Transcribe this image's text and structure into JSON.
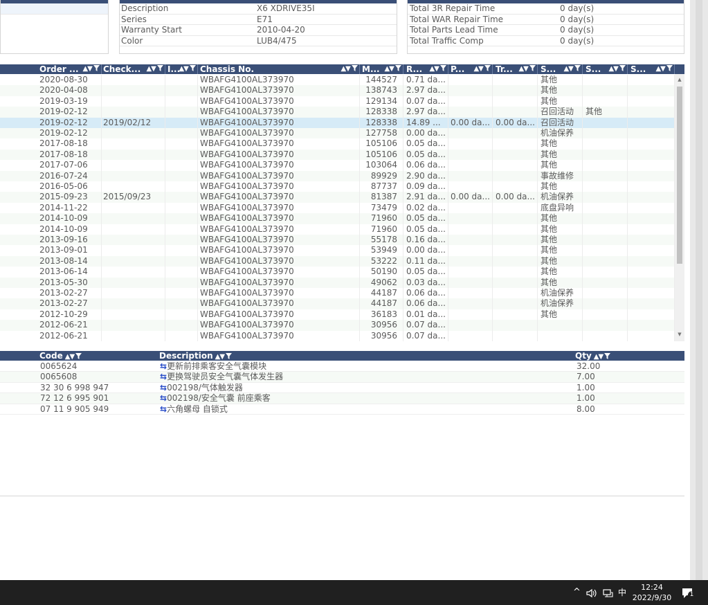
{
  "vehicle_panel": {
    "rows": [
      {
        "label": "Description",
        "value": "X6 XDRIVE35I"
      },
      {
        "label": "Series",
        "value": "E71"
      },
      {
        "label": "Warranty Start",
        "value": "2010-04-20"
      },
      {
        "label": "Color",
        "value": "LUB4/475"
      }
    ]
  },
  "totals_panel": {
    "rows": [
      {
        "label": "Total 3R Repair Time",
        "value": "0 day(s)"
      },
      {
        "label": "Total WAR Repair Time",
        "value": "0 day(s)"
      },
      {
        "label": "Total Parts Lead Time",
        "value": "0 day(s)"
      },
      {
        "label": "Total Traffic Comp",
        "value": "0 day(s)"
      }
    ]
  },
  "orders_grid": {
    "headers": [
      "Order ...",
      "Check...",
      "I...",
      "Chassis No.",
      "M...",
      "R...",
      "P...",
      "Tr...",
      "S...",
      "S...",
      "S..."
    ],
    "rows": [
      [
        "2020-08-30",
        "",
        "",
        "WBAFG4100AL373970",
        "144527",
        "0.71 da...",
        "",
        "",
        "其他",
        "",
        ""
      ],
      [
        "2020-04-08",
        "",
        "",
        "WBAFG4100AL373970",
        "138743",
        "2.97 da...",
        "",
        "",
        "其他",
        "",
        ""
      ],
      [
        "2019-03-19",
        "",
        "",
        "WBAFG4100AL373970",
        "129134",
        "0.07 da...",
        "",
        "",
        "其他",
        "",
        ""
      ],
      [
        "2019-02-12",
        "",
        "",
        "WBAFG4100AL373970",
        "128338",
        "2.97 da...",
        "",
        "",
        "召回活动",
        "其他",
        ""
      ],
      [
        "2019-02-12",
        "2019/02/12",
        "",
        "WBAFG4100AL373970",
        "128338",
        "14.89 ...",
        "0.00 da...",
        "0.00 da...",
        "召回活动",
        "",
        ""
      ],
      [
        "2019-02-12",
        "",
        "",
        "WBAFG4100AL373970",
        "127758",
        "0.00 da...",
        "",
        "",
        "机油保养",
        "",
        ""
      ],
      [
        "2017-08-18",
        "",
        "",
        "WBAFG4100AL373970",
        "105106",
        "0.05 da...",
        "",
        "",
        "其他",
        "",
        ""
      ],
      [
        "2017-08-18",
        "",
        "",
        "WBAFG4100AL373970",
        "105106",
        "0.05 da...",
        "",
        "",
        "其他",
        "",
        ""
      ],
      [
        "2017-07-06",
        "",
        "",
        "WBAFG4100AL373970",
        "103064",
        "0.06 da...",
        "",
        "",
        "其他",
        "",
        ""
      ],
      [
        "2016-07-24",
        "",
        "",
        "WBAFG4100AL373970",
        "89929",
        "2.90 da...",
        "",
        "",
        "事故维修",
        "",
        ""
      ],
      [
        "2016-05-06",
        "",
        "",
        "WBAFG4100AL373970",
        "87737",
        "0.09 da...",
        "",
        "",
        "其他",
        "",
        ""
      ],
      [
        "2015-09-23",
        "2015/09/23",
        "",
        "WBAFG4100AL373970",
        "81387",
        "2.91 da...",
        "0.00 da...",
        "0.00 da...",
        "机油保养",
        "",
        ""
      ],
      [
        "2014-11-22",
        "",
        "",
        "WBAFG4100AL373970",
        "73479",
        "0.02 da...",
        "",
        "",
        "底盘异响",
        "",
        ""
      ],
      [
        "2014-10-09",
        "",
        "",
        "WBAFG4100AL373970",
        "71960",
        "0.05 da...",
        "",
        "",
        "其他",
        "",
        ""
      ],
      [
        "2014-10-09",
        "",
        "",
        "WBAFG4100AL373970",
        "71960",
        "0.05 da...",
        "",
        "",
        "其他",
        "",
        ""
      ],
      [
        "2013-09-16",
        "",
        "",
        "WBAFG4100AL373970",
        "55178",
        "0.16 da...",
        "",
        "",
        "其他",
        "",
        ""
      ],
      [
        "2013-09-01",
        "",
        "",
        "WBAFG4100AL373970",
        "53949",
        "0.00 da...",
        "",
        "",
        "其他",
        "",
        ""
      ],
      [
        "2013-08-14",
        "",
        "",
        "WBAFG4100AL373970",
        "53222",
        "0.11 da...",
        "",
        "",
        "其他",
        "",
        ""
      ],
      [
        "2013-06-14",
        "",
        "",
        "WBAFG4100AL373970",
        "50190",
        "0.05 da...",
        "",
        "",
        "其他",
        "",
        ""
      ],
      [
        "2013-05-30",
        "",
        "",
        "WBAFG4100AL373970",
        "49062",
        "0.03 da...",
        "",
        "",
        "其他",
        "",
        ""
      ],
      [
        "2013-02-27",
        "",
        "",
        "WBAFG4100AL373970",
        "44187",
        "0.06 da...",
        "",
        "",
        "机油保养",
        "",
        ""
      ],
      [
        "2013-02-27",
        "",
        "",
        "WBAFG4100AL373970",
        "44187",
        "0.06 da...",
        "",
        "",
        "机油保养",
        "",
        ""
      ],
      [
        "2012-10-29",
        "",
        "",
        "WBAFG4100AL373970",
        "36183",
        "0.01 da...",
        "",
        "",
        "其他",
        "",
        ""
      ],
      [
        "2012-06-21",
        "",
        "",
        "WBAFG4100AL373970",
        "30956",
        "0.07 da...",
        "",
        "",
        "",
        "",
        ""
      ],
      [
        "2012-06-21",
        "",
        "",
        "WBAFG4100AL373970",
        "30956",
        "0.07 da...",
        "",
        "",
        "",
        "",
        ""
      ]
    ]
  },
  "parts_grid": {
    "headers": [
      "Code",
      "Description",
      "Qty"
    ],
    "rows": [
      [
        "0065624",
        "更新前排乘客安全气囊模块",
        "32.00"
      ],
      [
        "0065608",
        "更换驾驶员安全气囊气体发生器",
        "7.00"
      ],
      [
        "32 30 6 998 947",
        "002198/气体触发器",
        "1.00"
      ],
      [
        "72 12 6 995 901",
        "002198/安全气囊 前座乘客",
        "1.00"
      ],
      [
        "07 11 9 905 949",
        "六角螺母 自锁式",
        "8.00"
      ]
    ]
  },
  "taskbar": {
    "tray_caret": "^",
    "ime": "中",
    "time": "12:24",
    "date": "2022/9/30",
    "notification_count": "1"
  }
}
